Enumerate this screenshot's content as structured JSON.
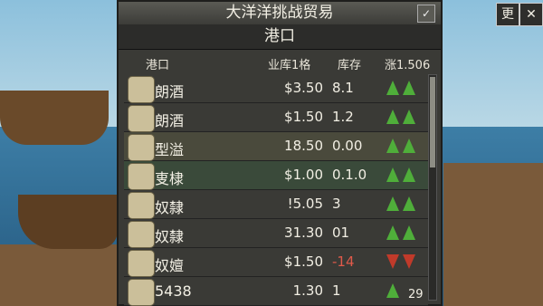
{
  "panel": {
    "title": "大洋洋挑战贸易",
    "subtitle": "港口"
  },
  "top_buttons": {
    "left": "更",
    "close": "✕"
  },
  "header": {
    "c1": "港口",
    "c2": "业库1格",
    "c3": "库存",
    "c4": "涨1.506"
  },
  "rows": [
    {
      "name": "朗酒",
      "price": "$3.50",
      "stock": "8.1",
      "arrows": [
        "up",
        "up"
      ],
      "hl": "#3a3a36"
    },
    {
      "name": "朗酒",
      "price": "$1.50",
      "stock": "1.2",
      "arrows": [
        "up",
        "up"
      ],
      "hl": "#3a3a36"
    },
    {
      "name": "型溢",
      "price": "18.50",
      "stock": "0.00",
      "arrows": [
        "up",
        "up"
      ],
      "hl": "#4a4a3c"
    },
    {
      "name": "叓棣",
      "price": "$1.00",
      "stock": "0.1.0",
      "arrows": [
        "up",
        "up"
      ],
      "hl": "#3a4a3a"
    },
    {
      "name": "奴隸",
      "price": "!5.05",
      "stock": "3",
      "arrows": [
        "up",
        "up"
      ],
      "hl": "#3a3a36"
    },
    {
      "name": "奴隸",
      "price": "31.30",
      "stock": "01",
      "arrows": [
        "up",
        "up"
      ],
      "hl": "#3a3a36"
    },
    {
      "name": "奴嬗",
      "price": "$1.50",
      "stock": "-14",
      "arrows": [
        "dn",
        "dn"
      ],
      "hl": "#3a3a36"
    },
    {
      "name": "5438",
      "price": "1.30",
      "stock": "1",
      "arrows": [
        "up"
      ],
      "hl": "#3a3a36",
      "extra": "29"
    }
  ]
}
